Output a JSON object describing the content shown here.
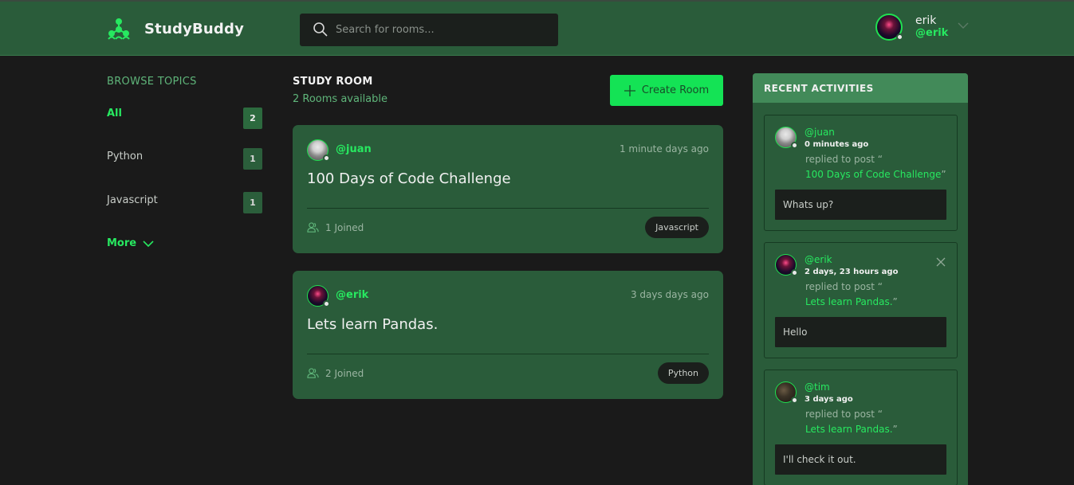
{
  "app": {
    "name": "StudyBuddy",
    "accent": "#27e860",
    "header_bg": "#2a5c3a",
    "page_bg": "#1a1a1a"
  },
  "search": {
    "placeholder": "Search for rooms..."
  },
  "user": {
    "name": "erik",
    "handle": "@erik"
  },
  "sidebar": {
    "title": "BROWSE TOPICS",
    "topics": [
      {
        "label": "All",
        "count": "2",
        "active": true
      },
      {
        "label": "Python",
        "count": "1"
      },
      {
        "label": "Javascript",
        "count": "1"
      }
    ],
    "more_label": "More"
  },
  "main": {
    "title": "STUDY ROOM",
    "subtitle": "2 Rooms available",
    "create_label": "Create Room",
    "rooms": [
      {
        "host": "@juan",
        "time": "1 minute days ago",
        "name": "100 Days of Code Challenge",
        "joined": "1 Joined",
        "topic": "Javascript"
      },
      {
        "host": "@erik",
        "time": "3 days days ago",
        "name": "Lets learn Pandas.",
        "joined": "2 Joined",
        "topic": "Python"
      }
    ]
  },
  "activities": {
    "title": "RECENT ACTIVITIES",
    "items": [
      {
        "user": "@juan",
        "time": "0 minutes ago",
        "action": "replied to post “",
        "post": "100 Days of Code Challenge",
        "close_quote": "”",
        "message": "Whats up?"
      },
      {
        "user": "@erik",
        "time": "2 days, 23 hours ago",
        "action": "replied to post “",
        "post": "Lets learn Pandas.",
        "close_quote": "”",
        "message": "Hello"
      },
      {
        "user": "@tim",
        "time": "3 days ago",
        "action": "replied to post “",
        "post": "Lets learn Pandas.",
        "close_quote": "”",
        "message": "I'll check it out."
      }
    ]
  }
}
